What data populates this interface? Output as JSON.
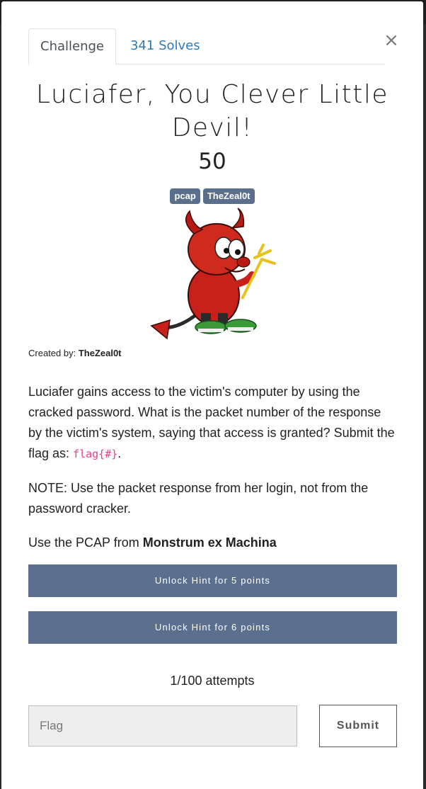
{
  "tabs": [
    {
      "label": "Challenge"
    },
    {
      "label": "341 Solves"
    }
  ],
  "close_label": "×",
  "challenge": {
    "title": "Luciafer, You Clever Little Devil!",
    "value": "50",
    "tags": [
      "pcap",
      "TheZeal0t"
    ],
    "created_by_label": "Created by:",
    "author": "TheZeal0t"
  },
  "description": {
    "p1_text": "Luciafer gains access to the victim's computer by using the cracked password. What is the packet number of the response by the victim's system, saying that access is granted? Submit the flag as: ",
    "p1_code": "flag{#}",
    "p1_end": ".",
    "p2": "NOTE: Use the packet response from her login, not from the password cracker.",
    "p3_text": "Use the PCAP from ",
    "p3_bold": "Monstrum ex Machina"
  },
  "hints": [
    {
      "label": "Unlock Hint for 5 points"
    },
    {
      "label": "Unlock Hint for 6 points"
    }
  ],
  "attempts": "1/100 attempts",
  "flag_input": {
    "placeholder": "Flag",
    "value": ""
  },
  "submit_label": "Submit",
  "colors": {
    "tag_bg": "#5a6f8c",
    "hint_bg": "#5b6f8f",
    "solves_link": "#2f7ab8",
    "code": "#e83e8c"
  },
  "image": {
    "icon": "bsd-daemon-mascot"
  }
}
